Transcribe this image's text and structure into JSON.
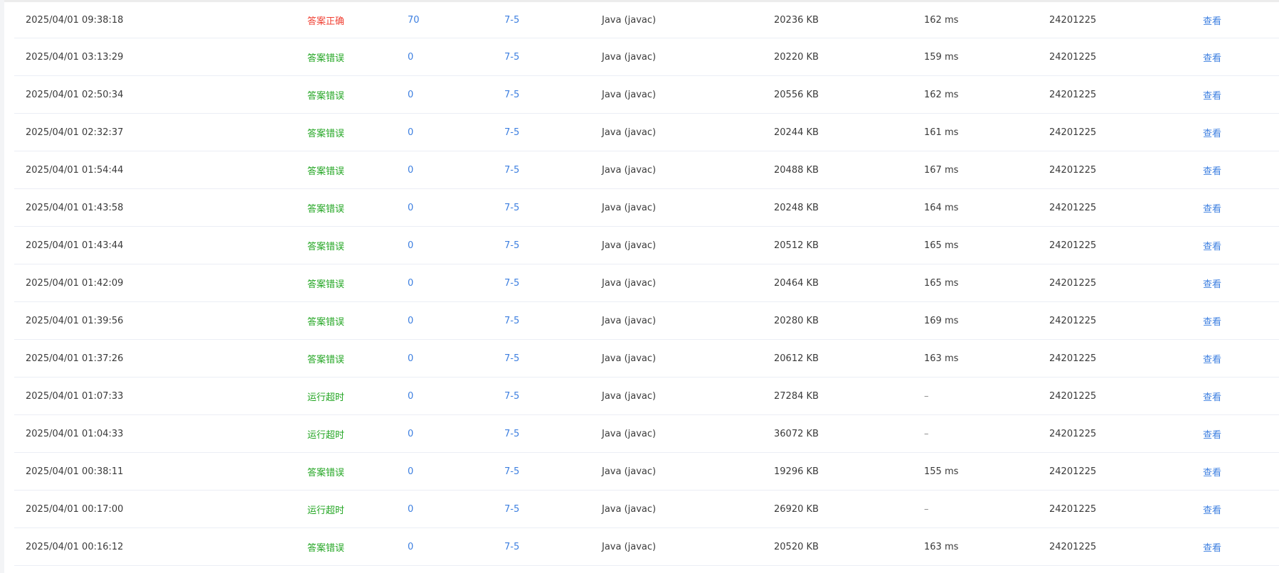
{
  "colors": {
    "correct": "#f04134",
    "wrong": "#21a521",
    "link": "#3d7fe0",
    "text": "#3a3a3a",
    "row_border": "#ebeef5"
  },
  "rows": [
    {
      "time": "2025/04/01 09:38:18",
      "status": "答案正确",
      "status_type": "correct",
      "score": "70",
      "problem": "7-5",
      "lang": "Java (javac)",
      "memory": "20236 KB",
      "runtime": "162 ms",
      "user": "24201225",
      "action": "查看"
    },
    {
      "time": "2025/04/01 03:13:29",
      "status": "答案错误",
      "status_type": "wrong",
      "score": "0",
      "problem": "7-5",
      "lang": "Java (javac)",
      "memory": "20220 KB",
      "runtime": "159 ms",
      "user": "24201225",
      "action": "查看"
    },
    {
      "time": "2025/04/01 02:50:34",
      "status": "答案错误",
      "status_type": "wrong",
      "score": "0",
      "problem": "7-5",
      "lang": "Java (javac)",
      "memory": "20556 KB",
      "runtime": "162 ms",
      "user": "24201225",
      "action": "查看"
    },
    {
      "time": "2025/04/01 02:32:37",
      "status": "答案错误",
      "status_type": "wrong",
      "score": "0",
      "problem": "7-5",
      "lang": "Java (javac)",
      "memory": "20244 KB",
      "runtime": "161 ms",
      "user": "24201225",
      "action": "查看"
    },
    {
      "time": "2025/04/01 01:54:44",
      "status": "答案错误",
      "status_type": "wrong",
      "score": "0",
      "problem": "7-5",
      "lang": "Java (javac)",
      "memory": "20488 KB",
      "runtime": "167 ms",
      "user": "24201225",
      "action": "查看"
    },
    {
      "time": "2025/04/01 01:43:58",
      "status": "答案错误",
      "status_type": "wrong",
      "score": "0",
      "problem": "7-5",
      "lang": "Java (javac)",
      "memory": "20248 KB",
      "runtime": "164 ms",
      "user": "24201225",
      "action": "查看"
    },
    {
      "time": "2025/04/01 01:43:44",
      "status": "答案错误",
      "status_type": "wrong",
      "score": "0",
      "problem": "7-5",
      "lang": "Java (javac)",
      "memory": "20512 KB",
      "runtime": "165 ms",
      "user": "24201225",
      "action": "查看"
    },
    {
      "time": "2025/04/01 01:42:09",
      "status": "答案错误",
      "status_type": "wrong",
      "score": "0",
      "problem": "7-5",
      "lang": "Java (javac)",
      "memory": "20464 KB",
      "runtime": "165 ms",
      "user": "24201225",
      "action": "查看"
    },
    {
      "time": "2025/04/01 01:39:56",
      "status": "答案错误",
      "status_type": "wrong",
      "score": "0",
      "problem": "7-5",
      "lang": "Java (javac)",
      "memory": "20280 KB",
      "runtime": "169 ms",
      "user": "24201225",
      "action": "查看"
    },
    {
      "time": "2025/04/01 01:37:26",
      "status": "答案错误",
      "status_type": "wrong",
      "score": "0",
      "problem": "7-5",
      "lang": "Java (javac)",
      "memory": "20612 KB",
      "runtime": "163 ms",
      "user": "24201225",
      "action": "查看"
    },
    {
      "time": "2025/04/01 01:07:33",
      "status": "运行超时",
      "status_type": "timeout",
      "score": "0",
      "problem": "7-5",
      "lang": "Java (javac)",
      "memory": "27284 KB",
      "runtime": "–",
      "user": "24201225",
      "action": "查看"
    },
    {
      "time": "2025/04/01 01:04:33",
      "status": "运行超时",
      "status_type": "timeout",
      "score": "0",
      "problem": "7-5",
      "lang": "Java (javac)",
      "memory": "36072 KB",
      "runtime": "–",
      "user": "24201225",
      "action": "查看"
    },
    {
      "time": "2025/04/01 00:38:11",
      "status": "答案错误",
      "status_type": "wrong",
      "score": "0",
      "problem": "7-5",
      "lang": "Java (javac)",
      "memory": "19296 KB",
      "runtime": "155 ms",
      "user": "24201225",
      "action": "查看"
    },
    {
      "time": "2025/04/01 00:17:00",
      "status": "运行超时",
      "status_type": "timeout",
      "score": "0",
      "problem": "7-5",
      "lang": "Java (javac)",
      "memory": "26920 KB",
      "runtime": "–",
      "user": "24201225",
      "action": "查看"
    },
    {
      "time": "2025/04/01 00:16:12",
      "status": "答案错误",
      "status_type": "wrong",
      "score": "0",
      "problem": "7-5",
      "lang": "Java (javac)",
      "memory": "20520 KB",
      "runtime": "163 ms",
      "user": "24201225",
      "action": "查看"
    }
  ]
}
